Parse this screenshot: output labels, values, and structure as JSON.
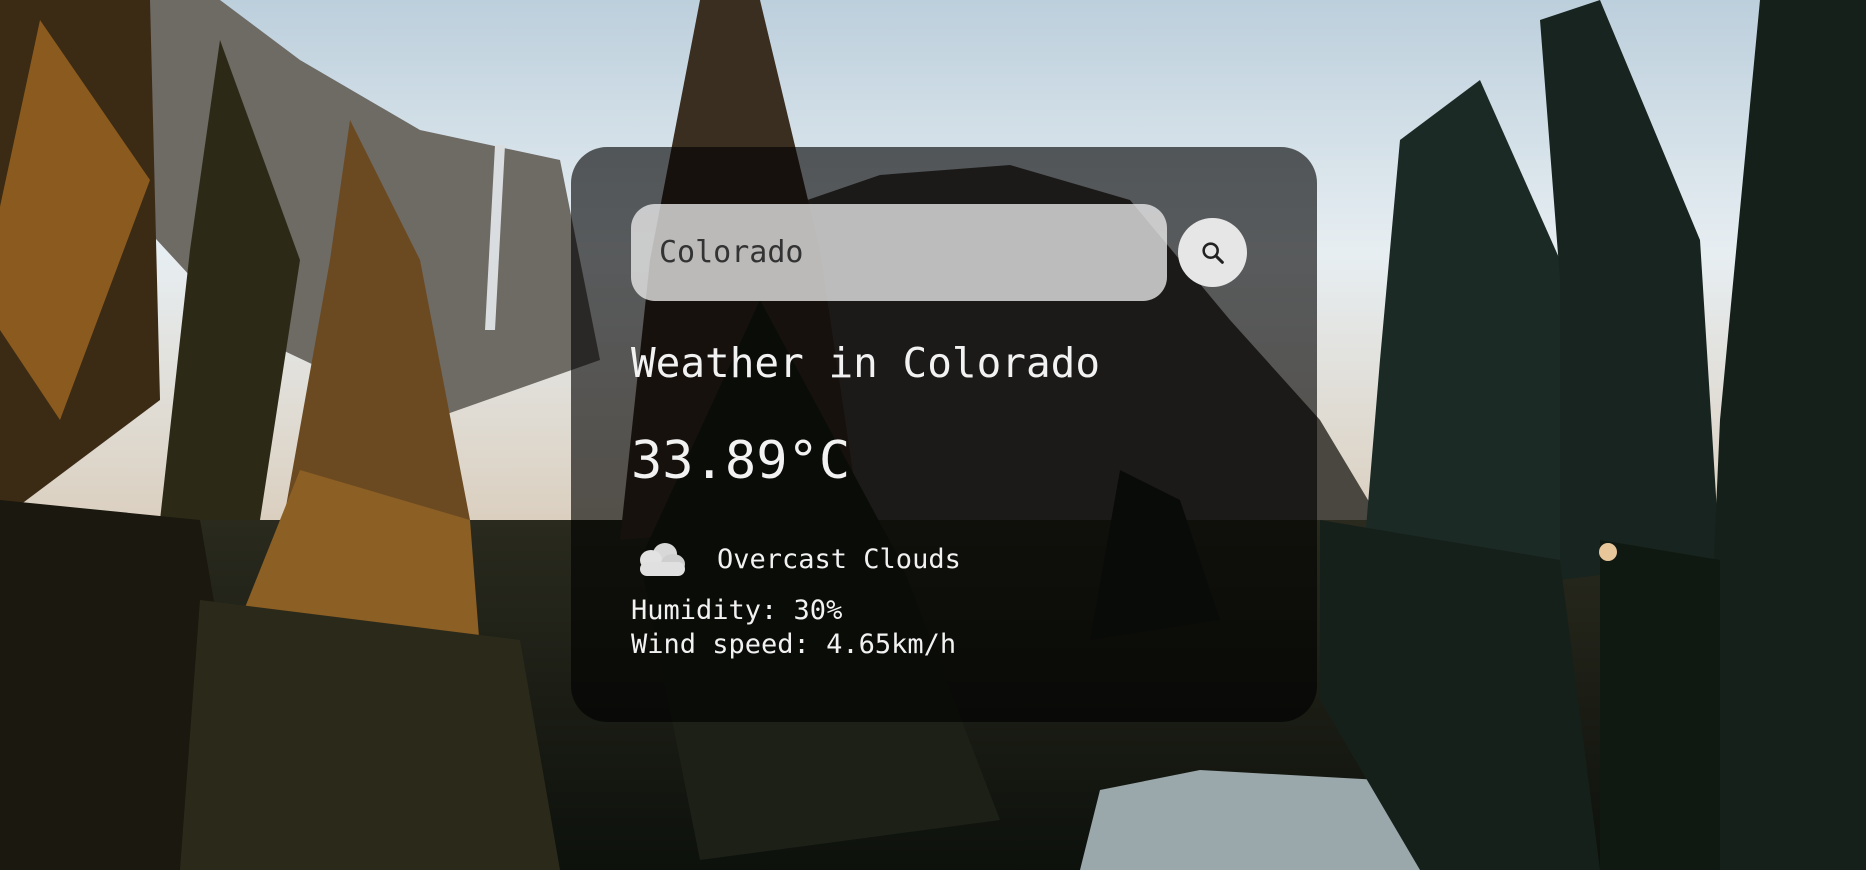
{
  "search": {
    "value": "Colorado"
  },
  "weather": {
    "title": "Weather in Colorado",
    "temperature": "33.89°C",
    "condition": "Overcast Clouds",
    "condition_icon": "cloud-icon",
    "humidity": "Humidity: 30%",
    "wind": "Wind speed: 4.65km/h"
  },
  "icons": {
    "search_button": "search-icon"
  },
  "colors": {
    "card_background": "#000000",
    "card_opacity": "0.62",
    "text": "#f2f2f2",
    "input_background": "#ebebeb",
    "button_background": "#e6e6e6"
  }
}
